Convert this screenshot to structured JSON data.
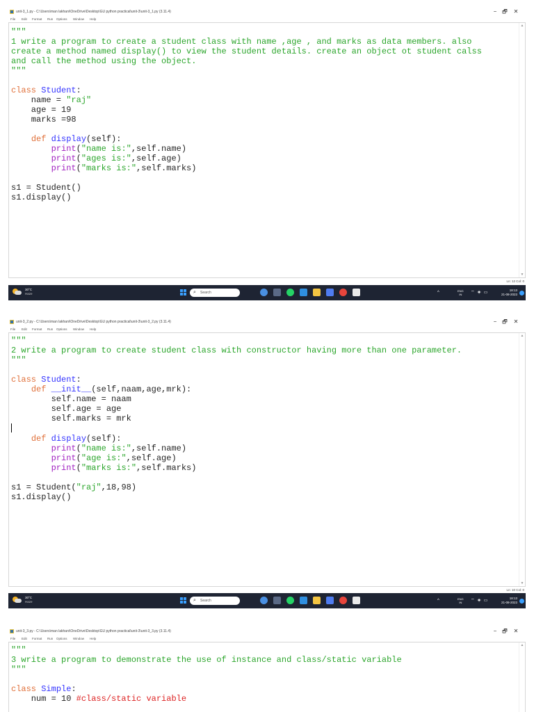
{
  "menu": [
    "File",
    "Edit",
    "Format",
    "Run",
    "Options",
    "Window",
    "Help"
  ],
  "window_controls": {
    "minimize": "−",
    "maximize": "🗗",
    "close": "✕"
  },
  "taskbar": {
    "temperature": "30°C",
    "condition": "Haze",
    "search_label": "Search",
    "tray_chevron": "^",
    "lang_top": "ENG",
    "lang_bottom": "IN",
    "clock_time": "18:13",
    "clock_date": "21-08-2023",
    "start_color": "#3aa0ff",
    "pinned_icons": [
      "browser-icon",
      "file-manager-icon",
      "whatsapp-icon",
      "vscode-icon",
      "file-explorer-icon",
      "notes-icon",
      "chrome-icon",
      "python-idle-icon"
    ]
  },
  "screenshots": [
    {
      "title": "unit-3_1.py - C:\\Users\\man lakhani\\OneDrive\\Desktop\\GU python practical\\unit-3\\unit-3_1.py (3.11.4)",
      "cursor": "Ln: 12   Col: 0",
      "code": [
        "\"\"\"",
        "1 write a program to create a student class with name ,age , and marks as data members. also",
        "create a method named display() to view the student details. create an object ot student calss",
        "and call the method using the object.",
        "\"\"\"",
        "",
        "class Student:",
        "    name = \"raj\"",
        "    age = 19",
        "    marks =98",
        "",
        "    def display(self):",
        "        print(\"name is:\",self.name)",
        "        print(\"ages is:\",self.age)",
        "        print(\"marks is:\",self.marks)",
        "",
        "s1 = Student()",
        "s1.display()"
      ]
    },
    {
      "title": "unit-3_2.py - C:\\Users\\man lakhani\\OneDrive\\Desktop\\GU python practical\\unit-3\\unit-3_2.py (3.11.4)",
      "cursor": "Ln: 10   Col: 0",
      "code": [
        "\"\"\"",
        "2 write a program to create student class with constructor having more than one parameter.",
        "\"\"\"",
        "",
        "class Student:",
        "    def __init__(self,naam,age,mrk):",
        "        self.name = naam",
        "        self.age = age",
        "        self.marks = mrk",
        "",
        "    def display(self):",
        "        print(\"name is:\",self.name)",
        "        print(\"age is:\",self.age)",
        "        print(\"marks is:\",self.marks)",
        "",
        "s1 = Student(\"raj\",18,98)",
        "s1.display()"
      ]
    },
    {
      "title": "unit-3_3.py - C:\\Users\\man lakhani\\OneDrive\\Desktop\\GU python practical\\unit-3\\unit-3_3.py (3.11.4)",
      "cursor": "",
      "code": [
        "\"\"\"",
        "3 write a program to demonstrate the use of instance and class/static variable",
        "\"\"\"",
        "",
        "class Simple:",
        "    num = 10 #class/static variable"
      ]
    }
  ]
}
